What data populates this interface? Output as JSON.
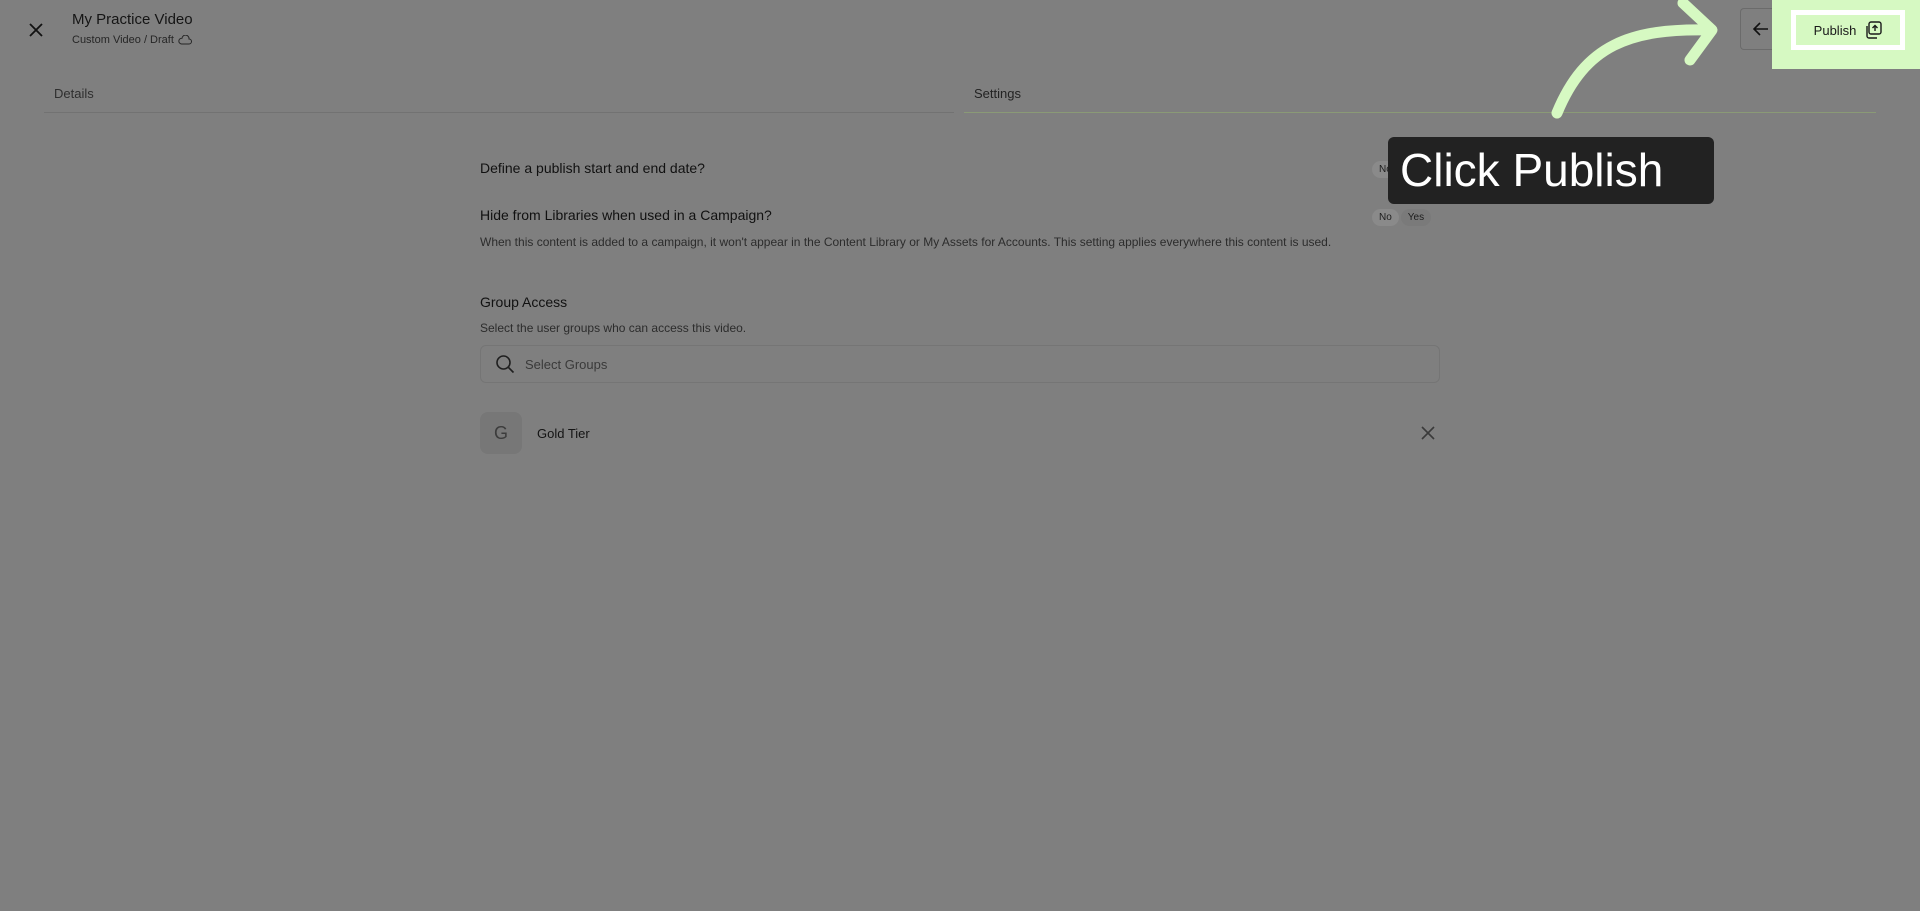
{
  "header": {
    "title": "My Practice Video",
    "breadcrumb": "Custom Video / Draft",
    "close_icon": "close-icon",
    "cloud_icon": "cloud-icon",
    "back_icon": "arrow-left-icon",
    "publish_label": "Publish",
    "publish_icon": "publish-icon"
  },
  "tabs": [
    {
      "label": "Details",
      "active": false
    },
    {
      "label": "Settings",
      "active": true
    }
  ],
  "settings": {
    "publish_dates": {
      "label": "Define a publish start and end date?",
      "toggle_visible": "No"
    },
    "hide_from_libraries": {
      "label": "Hide from Libraries when used in a Campaign?",
      "description": "When this content is added to a campaign, it won't appear in the Content Library or My Assets for Accounts. This setting applies everywhere this content is used.",
      "options": [
        "No",
        "Yes"
      ],
      "selected": "No"
    },
    "group_access": {
      "label": "Group Access",
      "description": "Select the user groups who can access this video.",
      "search_placeholder": "Select Groups",
      "groups": [
        {
          "initial": "G",
          "name": "Gold Tier"
        }
      ]
    }
  },
  "overlay": {
    "callout_text": "Click Publish",
    "accent_color": "#d6f9c2",
    "dim_color": "#7f7f7f"
  }
}
